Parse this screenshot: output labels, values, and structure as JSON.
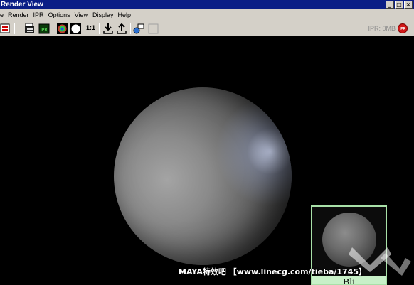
{
  "window": {
    "title": "Render View",
    "controls": [
      "_",
      "□",
      "×"
    ]
  },
  "menubar": {
    "items": [
      "e",
      "Render",
      "IPR",
      "Options",
      "View",
      "Display",
      "Help"
    ]
  },
  "toolbar": {
    "ratio_label": "1:1",
    "memory_label": "IPR: 0MB",
    "ipr_badge": "IPR"
  },
  "thumbnail": {
    "label": "Bli"
  },
  "watermark": {
    "text": "MAYA特效吧 【www.linecg.com/tieba/1745】"
  }
}
